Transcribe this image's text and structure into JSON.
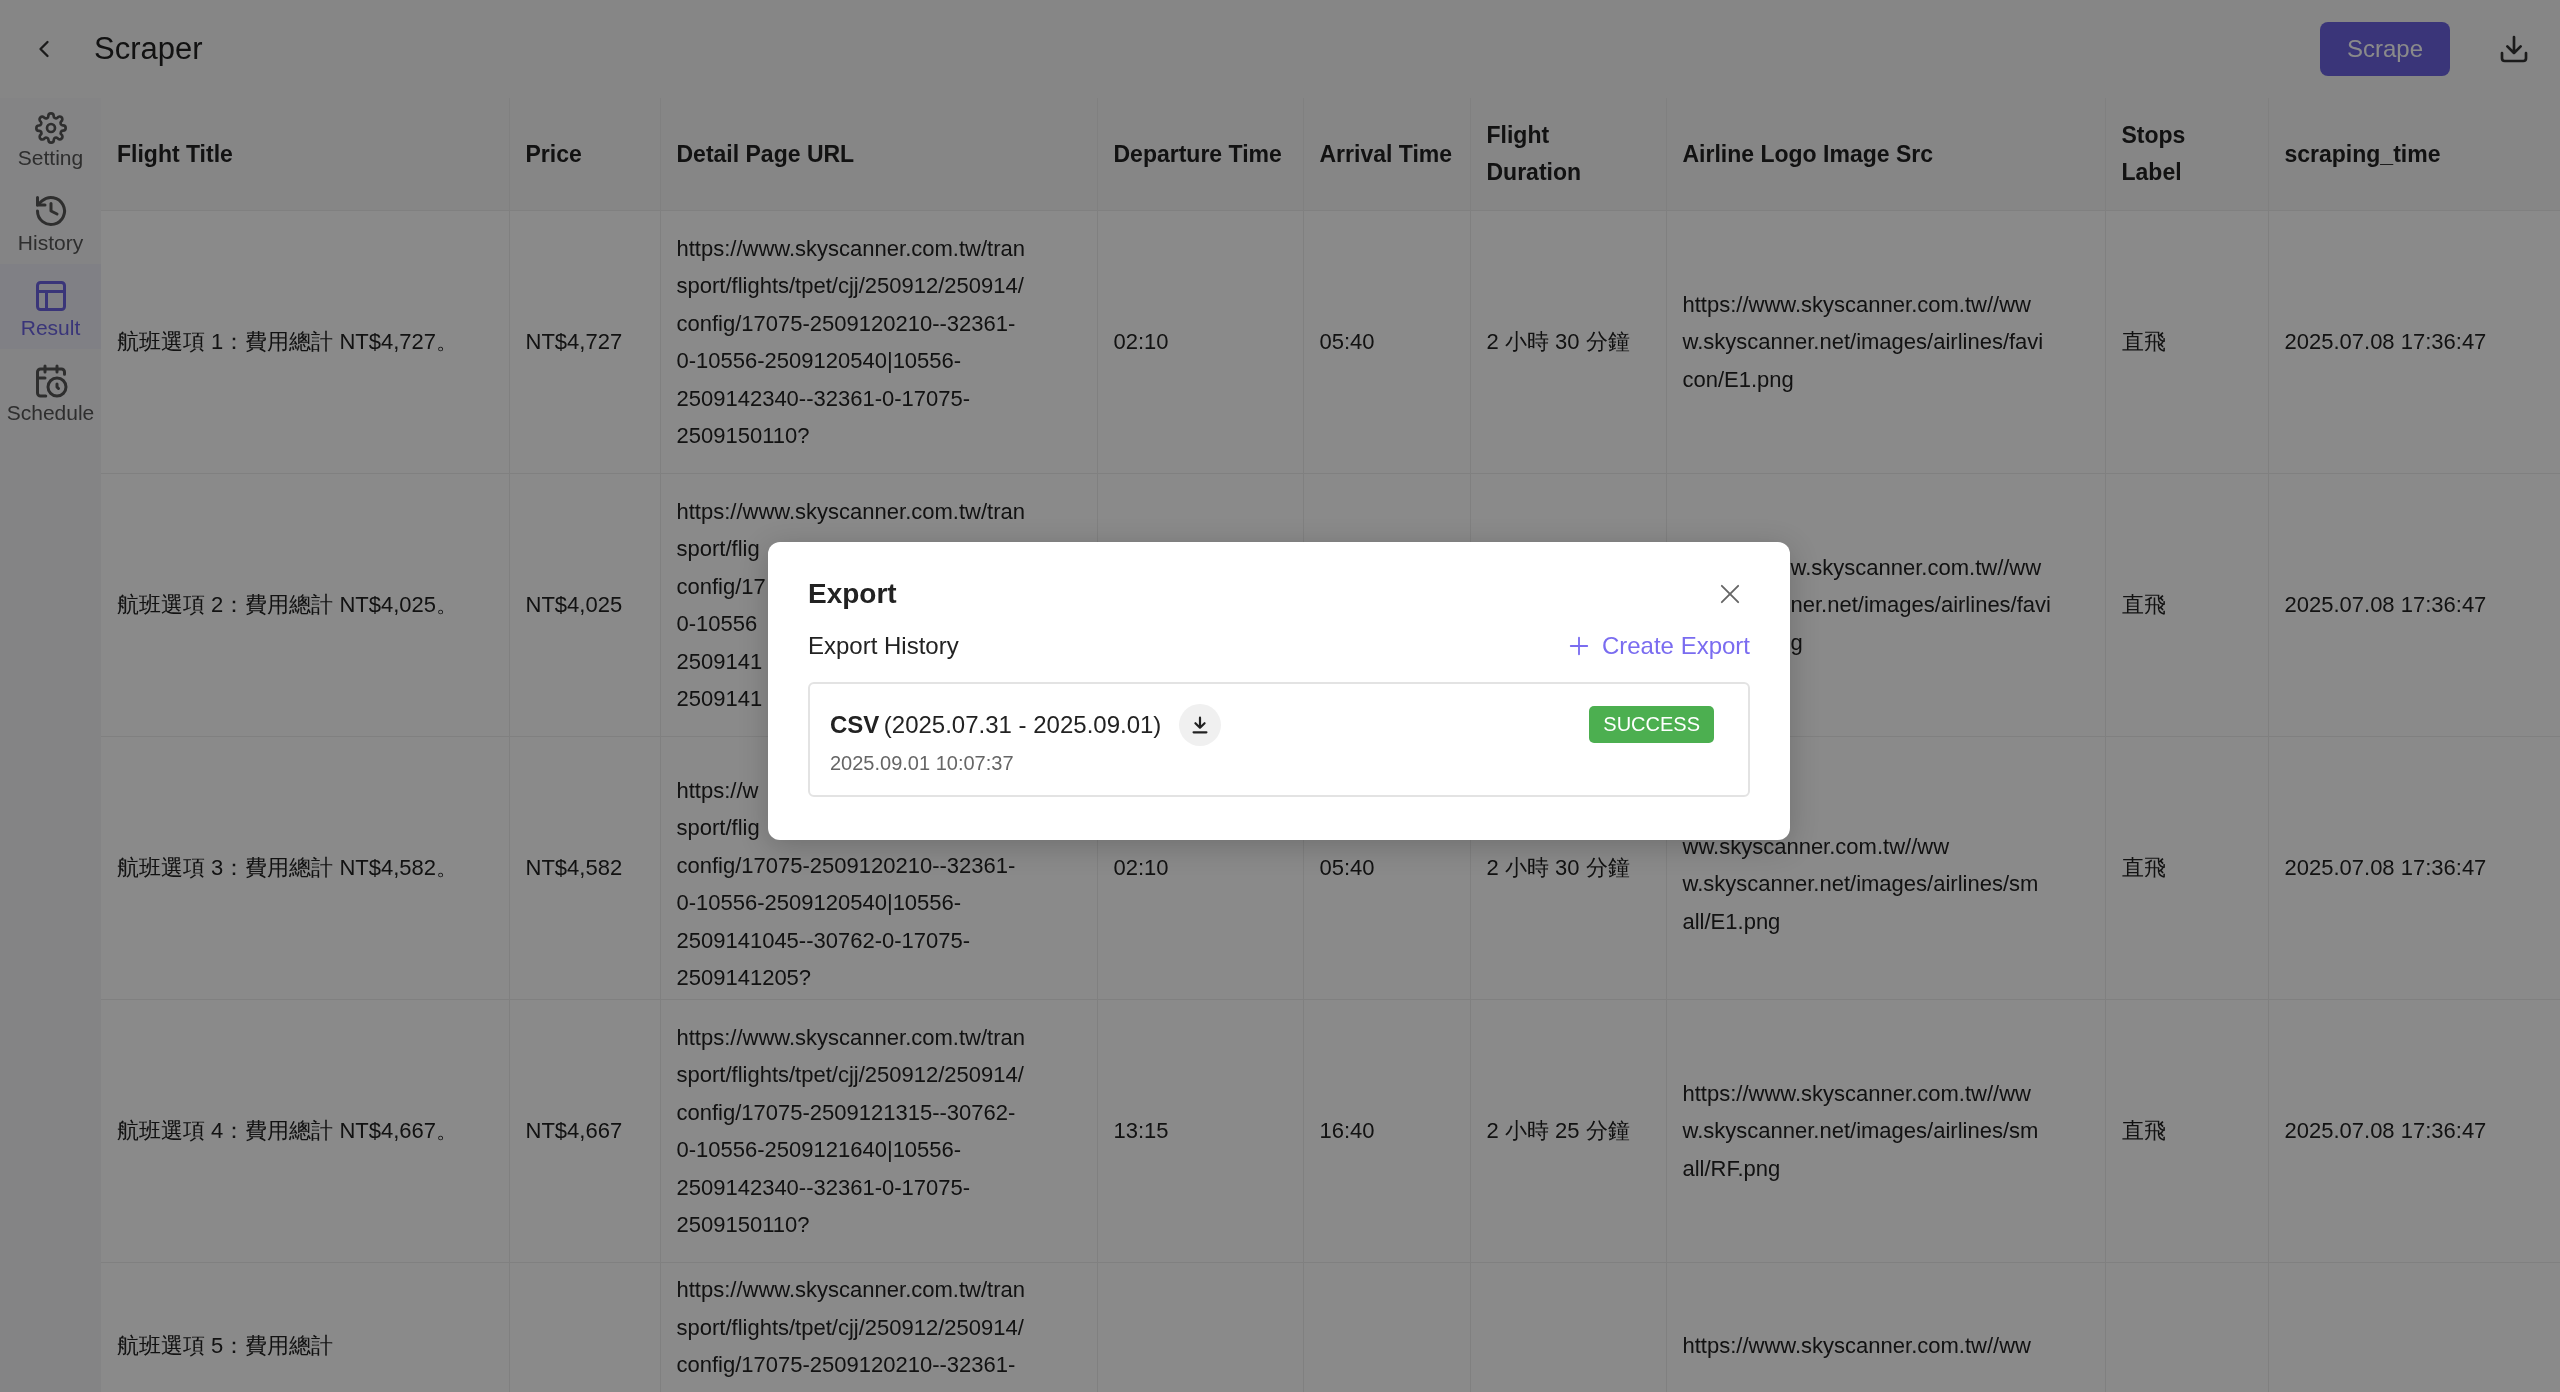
{
  "header": {
    "title": "Scraper",
    "scrape_button": "Scrape"
  },
  "sidebar": {
    "items": [
      {
        "label": "Setting",
        "selected": false
      },
      {
        "label": "History",
        "selected": false
      },
      {
        "label": "Result",
        "selected": true
      },
      {
        "label": "Schedule",
        "selected": false
      }
    ]
  },
  "table": {
    "columns": [
      "Flight Title",
      "Price",
      "Detail Page URL",
      "Departure Time",
      "Arrival Time",
      "Flight Duration",
      "Airline Logo Image Src",
      "Stops Label",
      "scraping_time"
    ],
    "rows": [
      {
        "kind": "full",
        "cells": [
          "航班選項 1：費用總計 NT$4,727。",
          "NT$4,727",
          [
            "https://www.skyscanner.com.tw/tran",
            "sport/flights/tpet/cjj/250912/250914/",
            "config/17075-2509120210--32361-",
            "0-10556-2509120540|10556-",
            "2509142340--32361-0-17075-",
            "2509150110?"
          ],
          "02:10",
          "05:40",
          "2 小時 30 分鐘",
          [
            "https://www.skyscanner.com.tw//ww",
            "w.skyscanner.net/images/airlines/favi",
            "con/E1.png"
          ],
          "直飛",
          "2025.07.08 17:36:47"
        ]
      },
      {
        "kind": "full",
        "cells": [
          "航班選項 2：費用總計 NT$4,025。",
          "NT$4,025",
          [
            "https://www.skyscanner.com.tw/tran",
            "sport/flig",
            "config/17",
            "0-10556",
            "2509141",
            "2509141"
          ],
          null,
          null,
          null,
          {
            "kind": "tail",
            "lines": [
              "w.skyscanner.com.tw//ww",
              "ner.net/images/airlines/favi",
              "g"
            ]
          },
          "直飛",
          "2025.07.08 17:36:47"
        ]
      },
      {
        "kind": "full",
        "cells": [
          "航班選項 3：費用總計 NT$4,582。",
          "NT$4,582",
          {
            "kind": "shifted",
            "lines": [
              "https://w",
              "sport/flig",
              "config/17075-2509120210--32361-",
              "0-10556-2509120540|10556-",
              "2509141045--30762-0-17075-",
              "2509141205?"
            ]
          },
          "02:10",
          "05:40",
          "2 小時 30 分鐘",
          {
            "kind": "shifted",
            "lines": [
              "ww.skyscanner.com.tw//ww",
              "w.skyscanner.net/images/airlines/sm",
              "all/E1.png"
            ]
          },
          "直飛",
          "2025.07.08 17:36:47"
        ]
      },
      {
        "kind": "full",
        "cells": [
          "航班選項 4：費用總計 NT$4,667。",
          "NT$4,667",
          [
            "https://www.skyscanner.com.tw/tran",
            "sport/flights/tpet/cjj/250912/250914/",
            "config/17075-2509121315--30762-",
            "0-10556-2509121640|10556-",
            "2509142340--32361-0-17075-",
            "2509150110?"
          ],
          "13:15",
          "16:40",
          "2 小時 25 分鐘",
          [
            "https://www.skyscanner.com.tw//ww",
            "w.skyscanner.net/images/airlines/sm",
            "all/RF.png"
          ],
          "直飛",
          "2025.07.08 17:36:47"
        ]
      },
      {
        "kind": "cut",
        "cells": [
          "航班選項 5：費用總計",
          null,
          [
            "https://www.skyscanner.com.tw/tran",
            "sport/flights/tpet/cjj/250912/250914/",
            "config/17075-2509120210--32361-"
          ],
          null,
          null,
          null,
          [
            "https://www.skyscanner.com.tw//ww"
          ],
          null,
          null
        ]
      }
    ]
  },
  "dialog": {
    "title": "Export",
    "section": "Export History",
    "create_button": "Create Export",
    "exports": [
      {
        "format": "CSV",
        "range": "(2025.07.31 - 2025.09.01)",
        "time": "2025.09.01 10:07:37",
        "status": "SUCCESS",
        "kind": "success"
      }
    ]
  }
}
